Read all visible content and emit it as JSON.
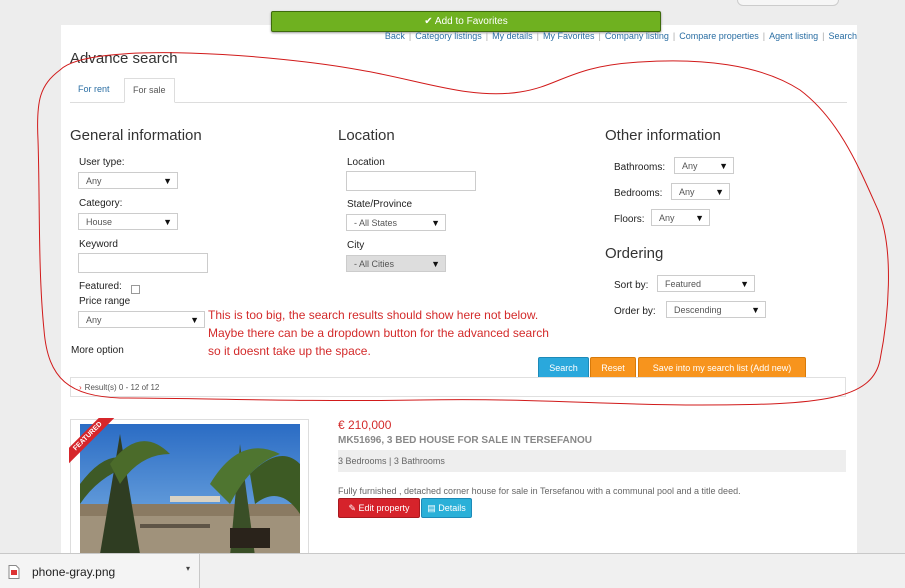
{
  "favorites_button": "Add to Favorites",
  "topnav": [
    "Back",
    "Category listings",
    "My details",
    "My Favorites",
    "Company listing",
    "Compare properties",
    "Agent listing",
    "Search"
  ],
  "advance_search_title": "Advance search",
  "tabs": [
    "For rent",
    "For sale"
  ],
  "general": {
    "heading": "General information",
    "user_type_label": "User type:",
    "user_type_value": "Any",
    "category_label": "Category:",
    "category_value": "House",
    "keyword_label": "Keyword",
    "featured_label": "Featured:",
    "price_range_label": "Price range",
    "price_range_value": "Any",
    "more_option": "More option"
  },
  "location": {
    "heading": "Location",
    "location_label": "Location",
    "state_label": "State/Province",
    "state_value": "- All States",
    "city_label": "City",
    "city_value": "- All Cities"
  },
  "other": {
    "heading": "Other information",
    "bathrooms_label": "Bathrooms:",
    "bathrooms_value": "Any",
    "bedrooms_label": "Bedrooms:",
    "bedrooms_value": "Any",
    "floors_label": "Floors:",
    "floors_value": "Any"
  },
  "ordering": {
    "heading": "Ordering",
    "sort_label": "Sort by:",
    "sort_value": "Featured",
    "order_label": "Order by:",
    "order_value": "Descending"
  },
  "buttons": {
    "search": "Search",
    "reset": "Reset",
    "save": "Save into my search list (Add new)"
  },
  "results": "Result(s) 0 - 12 of 12",
  "annotation_note": [
    "This is too big, the search results should show here not below.",
    "Maybe there can be a dropdown button for the advanced search",
    "so it doesnt take up the space."
  ],
  "listing": {
    "badge": "FEATURED",
    "price": "€ 210,000",
    "title": "MK51696, 3 BED HOUSE FOR SALE IN TERSEFANOU",
    "specs": "3 Bedrooms | 3 Bathrooms",
    "description": "Fully furnished , detached corner house for sale in Tersefanou with a communal pool and a title deed.",
    "edit_button": "Edit property",
    "details_button": "Details"
  },
  "download_bar": {
    "filename": "phone-gray.png"
  },
  "colors": {
    "accent_green": "#6fb120",
    "link_blue": "#2a6ea3",
    "annotation_red": "#d32b2b",
    "button_blue": "#2aa8dc",
    "button_orange": "#f7941d"
  }
}
